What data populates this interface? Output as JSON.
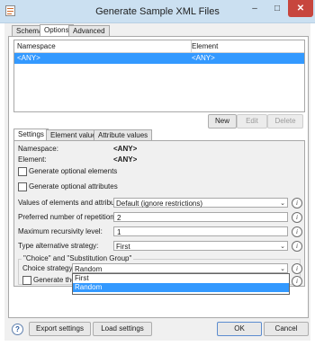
{
  "window": {
    "title": "Generate Sample XML Files",
    "minimize": "–",
    "maximize": "□",
    "close": "✕"
  },
  "main_tabs": [
    "Schema",
    "Options",
    "Advanced"
  ],
  "table": {
    "columns": [
      "Namespace",
      "Element"
    ],
    "rows": [
      [
        "<ANY>",
        "<ANY>"
      ]
    ]
  },
  "table_buttons": {
    "new": "New",
    "edit": "Edit",
    "delete": "Delete"
  },
  "sub_tabs": [
    "Settings",
    "Element values",
    "Attribute values"
  ],
  "settings": {
    "namespace_label": "Namespace:",
    "namespace_value": "<ANY>",
    "element_label": "Element:",
    "element_value": "<ANY>",
    "gen_optional_elements": "Generate optional elements",
    "gen_optional_attributes": "Generate optional attributes",
    "values_label": "Values of elements and attributes:",
    "values_selected": "Default (ignore restrictions)",
    "preferred_reps_label": "Preferred number of repetitions:",
    "preferred_reps_value": "2",
    "max_recursivity_label": "Maximum recursivity level:",
    "max_recursivity_value": "1",
    "type_alt_label": "Type alternative strategy:",
    "type_alt_selected": "First",
    "group_label": "\"Choice\" and \"Substitution Group\"",
    "choice_label": "Choice strategy:",
    "choice_selected": "Random",
    "choice_options": [
      "First",
      "Random"
    ],
    "generate_the_partial": "Generate the"
  },
  "footer": {
    "help": "?",
    "export": "Export settings",
    "load": "Load settings",
    "ok": "OK",
    "cancel": "Cancel"
  },
  "info_glyph": "i",
  "colors": {
    "titlebar": "#cbe0f1",
    "close": "#c7463e",
    "selection": "#3399ff"
  }
}
